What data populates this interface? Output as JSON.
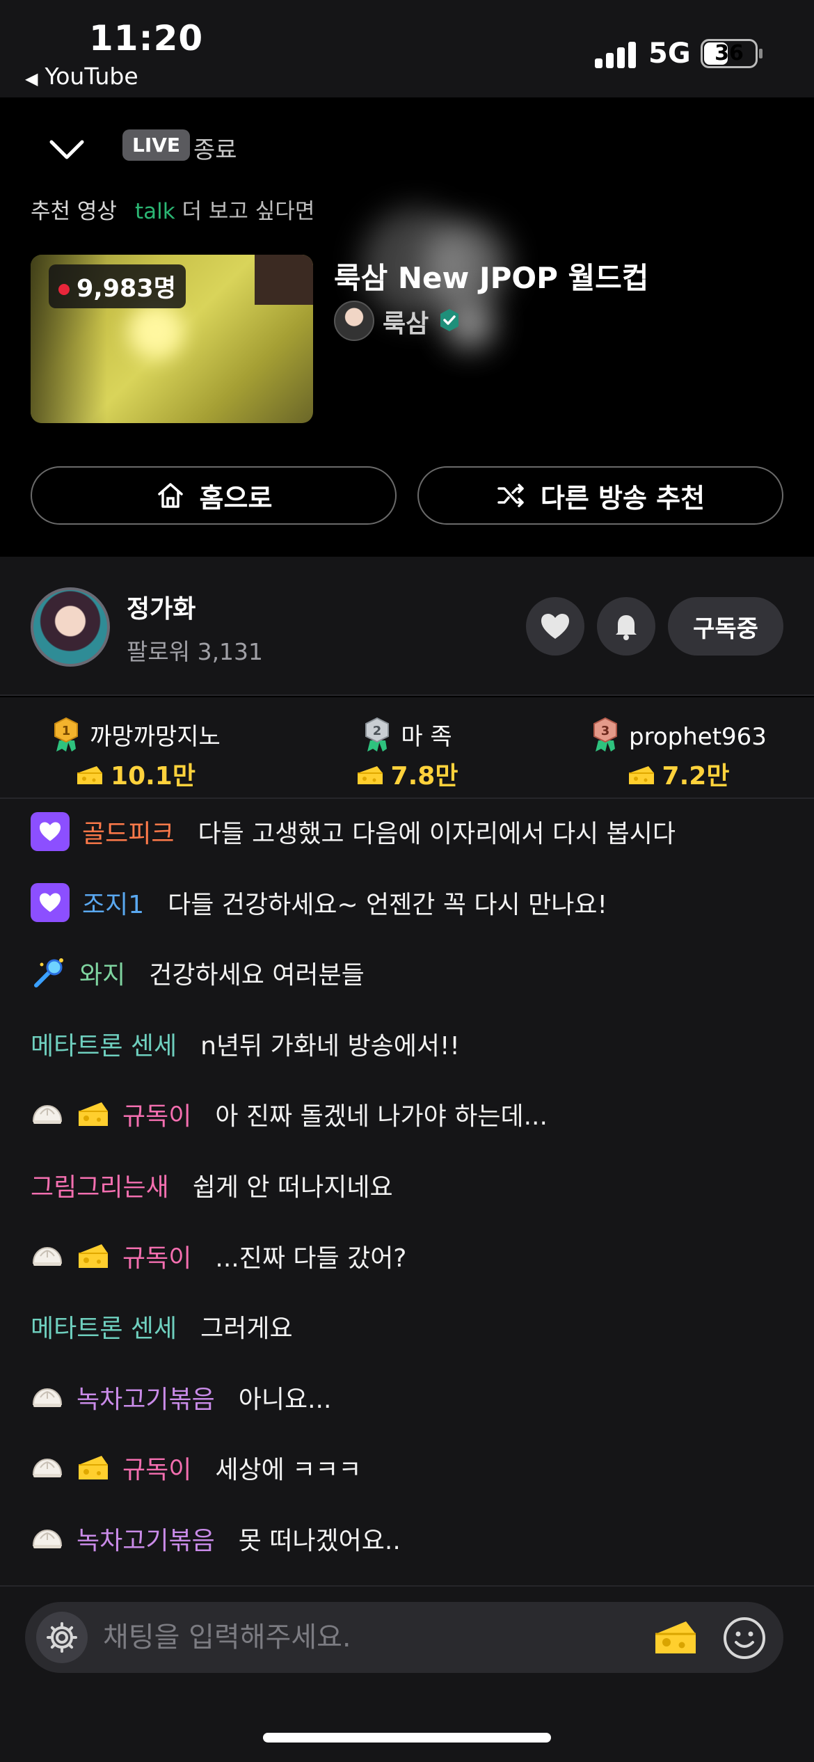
{
  "status_bar": {
    "time": "11:20",
    "back_app": "YouTube",
    "network": "5G",
    "battery": "36"
  },
  "ended": {
    "live_badge": "LIVE",
    "ended_label": "종료",
    "recommend_label": "추천 영상",
    "talk_label": "talk",
    "more_label": "더 보고 싶다면",
    "viewer_count": "9,983명",
    "title": "룩삼 New JPOP 월드컵",
    "channel_name": "룩삼",
    "home_button": "홈으로",
    "other_button": "다른 방송 추천"
  },
  "channel": {
    "name": "정가화",
    "followers": "팔로워 3,131",
    "subscribe_button": "구독중"
  },
  "ranking": [
    {
      "rank": 1,
      "name": "까망까망지노",
      "amount": "10.1만"
    },
    {
      "rank": 2,
      "name": "마 족",
      "amount": "7.8만"
    },
    {
      "rank": 3,
      "name": "prophet963",
      "amount": "7.2만"
    }
  ],
  "chat": {
    "messages": [
      {
        "badges": [
          "sub"
        ],
        "nick": "골드피크",
        "color": "#ff7a4a",
        "text": "다들 고생했고 다음에 이자리에서 다시 봅시다"
      },
      {
        "badges": [
          "sub"
        ],
        "nick": "조지1",
        "color": "#5aa8f0",
        "text": "다들 건강하세요~ 언젠간 꼭 다시 만나요!"
      },
      {
        "badges": [
          "wand"
        ],
        "nick": "와지",
        "color": "#7fd4a0",
        "text": "건강하세요 여러분들"
      },
      {
        "badges": [],
        "nick": "메타트론 센세",
        "color": "#6fd0bf",
        "text": "n년뒤 가화네 방송에서!!"
      },
      {
        "badges": [
          "bun",
          "cheese"
        ],
        "nick": "규독이",
        "color": "#f46fb0",
        "text": "아 진짜 돌겠네 나가야 하는데..."
      },
      {
        "badges": [],
        "nick": "그림그리는새",
        "color": "#f46fb0",
        "text": "쉽게 안 떠나지네요"
      },
      {
        "badges": [
          "bun",
          "cheese"
        ],
        "nick": "규독이",
        "color": "#f46fb0",
        "text": "...진짜 다들 갔어?"
      },
      {
        "badges": [],
        "nick": "메타트론 센세",
        "color": "#6fd0bf",
        "text": "그러게요"
      },
      {
        "badges": [
          "bun"
        ],
        "nick": "녹차고기볶음",
        "color": "#c98be8",
        "text": "아니요..."
      },
      {
        "badges": [
          "bun",
          "cheese"
        ],
        "nick": "규독이",
        "color": "#f46fb0",
        "text": "세상에 ㅋㅋㅋ"
      },
      {
        "badges": [
          "bun"
        ],
        "nick": "녹차고기볶음",
        "color": "#c98be8",
        "text": "못 떠나겠어요.."
      }
    ],
    "input_placeholder": "채팅을 입력해주세요."
  },
  "colors": {
    "accent_green": "#2bb673",
    "gold": "#ffd23c",
    "live_dot": "#e8263a",
    "sub_badge": "#8c4fff"
  }
}
